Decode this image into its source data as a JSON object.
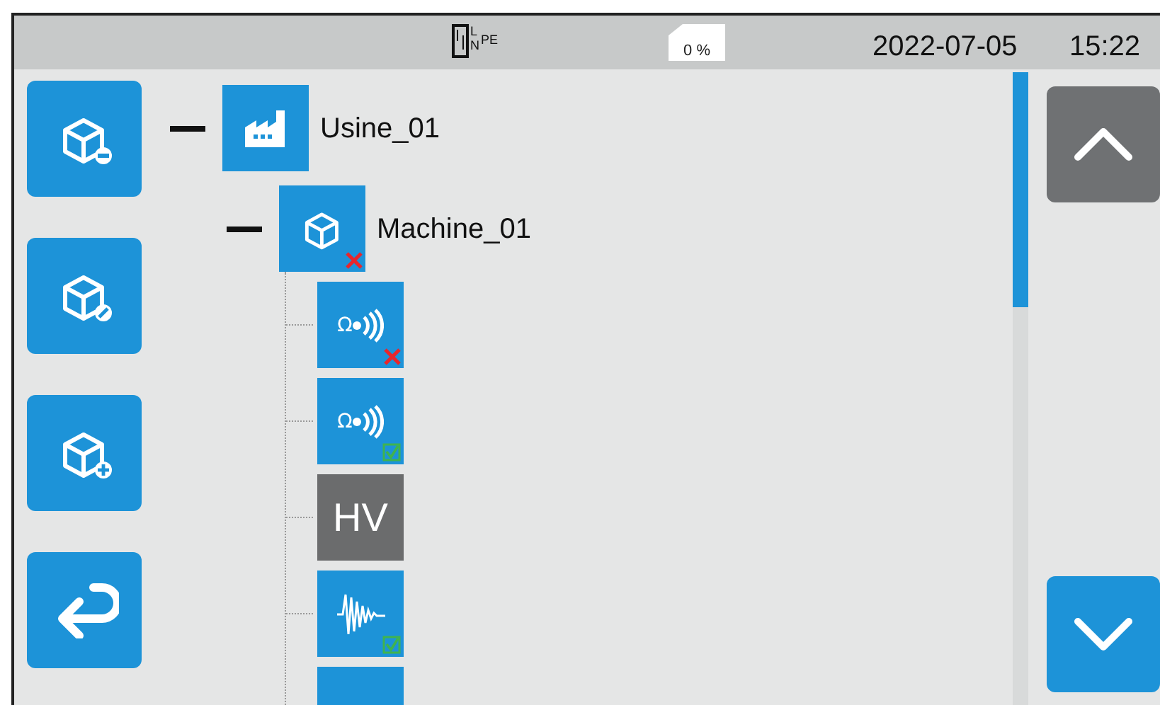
{
  "status_bar": {
    "wiring": {
      "l": "L",
      "n": "N",
      "pe": "PE"
    },
    "memory": "0 %",
    "date": "2022-07-05",
    "time": "15:22"
  },
  "side_buttons": [
    {
      "kind": "collapse"
    },
    {
      "kind": "edit"
    },
    {
      "kind": "add"
    },
    {
      "kind": "back"
    }
  ],
  "tree": [
    {
      "kind": "plant",
      "label": "Usine_01",
      "expanded": true,
      "children": [
        {
          "kind": "machine",
          "label": "Machine_01",
          "expanded": true,
          "passed": false,
          "children": [
            {
              "kind": "insulation",
              "symbol": "Ω",
              "passed": false
            },
            {
              "kind": "insulation",
              "symbol": "Ω",
              "passed": true
            },
            {
              "kind": "hv",
              "text": "HV"
            },
            {
              "kind": "discharge",
              "passed": true
            },
            {
              "kind": "partial"
            }
          ]
        }
      ]
    }
  ],
  "scroll_buttons": [
    {
      "kind": "up",
      "disabled": true
    },
    {
      "kind": "down",
      "disabled": false
    }
  ]
}
